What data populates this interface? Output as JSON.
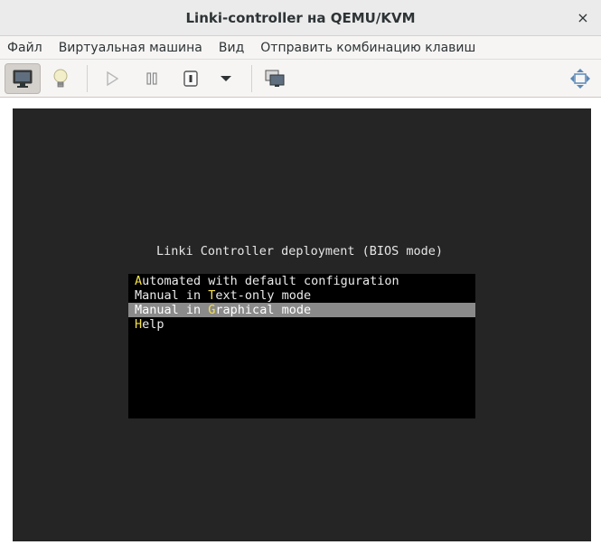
{
  "window": {
    "title": "Linki-controller на QEMU/KVM",
    "close_glyph": "×"
  },
  "menubar": {
    "items": [
      "Файл",
      "Виртуальная машина",
      "Вид",
      "Отправить комбинацию клавиш"
    ]
  },
  "toolbar": {
    "buttons": [
      {
        "icon": "monitor-icon",
        "active": true
      },
      {
        "icon": "lightbulb-icon",
        "active": false
      },
      {
        "icon": "play-icon",
        "active": false
      },
      {
        "icon": "pause-icon",
        "active": false
      },
      {
        "icon": "power-icon",
        "active": false
      },
      {
        "icon": "chevron-down-icon",
        "active": false
      },
      {
        "icon": "snapshots-icon",
        "active": false
      },
      {
        "icon": "fullscreen-icon",
        "active": false
      }
    ]
  },
  "boot": {
    "title": "Linki Controller deployment (BIOS mode)",
    "hotkey_color": "#f4e04d",
    "items": [
      {
        "hotkey": "A",
        "rest": "utomated with default configuration",
        "selected": false
      },
      {
        "prefix": "Manual in ",
        "hotkey": "T",
        "rest": "ext-only mode",
        "selected": false
      },
      {
        "prefix": "Manual in ",
        "hotkey": "G",
        "rest": "raphical mode",
        "selected": true
      },
      {
        "hotkey": "H",
        "rest": "elp",
        "selected": false
      }
    ]
  }
}
